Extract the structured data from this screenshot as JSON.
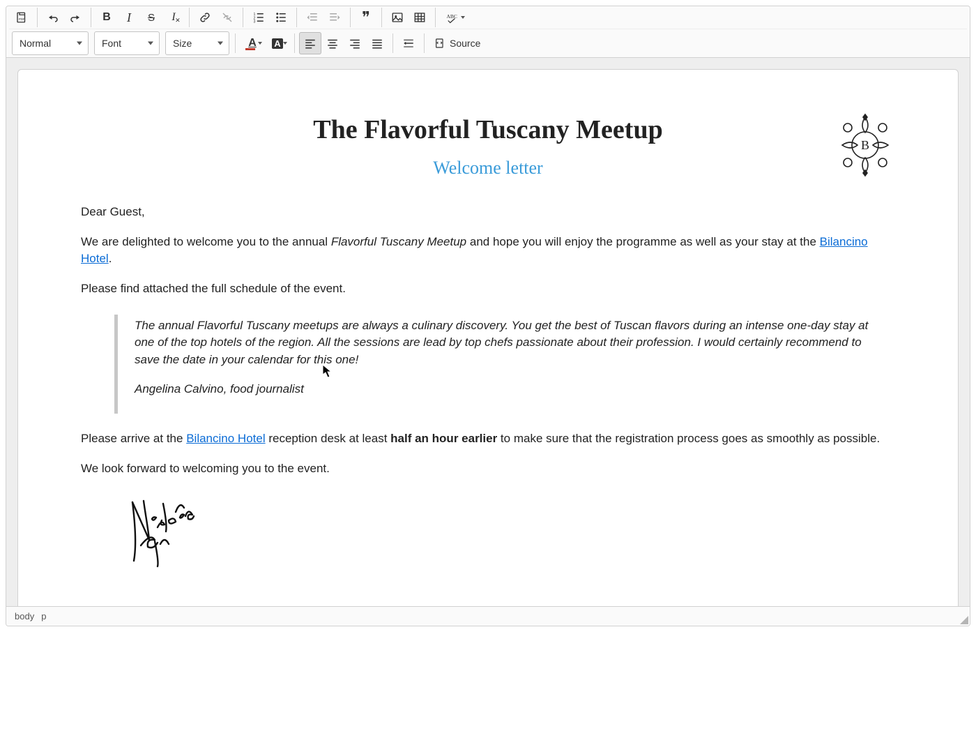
{
  "toolbar": {
    "format_heading": "Normal",
    "font_label": "Font",
    "size_label": "Size",
    "source_label": "Source"
  },
  "colors": {
    "text_color": "#c0392b",
    "accent": "#3a9bd9",
    "link": "#0b6cd6"
  },
  "document": {
    "title": "The Flavorful Tuscany Meetup",
    "subtitle": "Welcome letter",
    "greeting": "Dear Guest,",
    "intro_before_italic": "We are delighted to welcome you to the annual ",
    "intro_italic": "Flavorful Tuscany Meetup",
    "intro_after_italic": " and hope you will enjoy the programme as well as your stay at the ",
    "link_hotel": "Bilancino Hotel",
    "intro_end": ".",
    "schedule_line": "Please find attached the full schedule of the event.",
    "quote_body": "The annual Flavorful Tuscany meetups are always a culinary discovery. You get the best of Tuscan flavors during an intense one-day stay at one of the top hotels of the region. All the sessions are lead by top chefs passionate about their profession. I would certainly recommend to save the date in your calendar for this one!",
    "quote_attr": "Angelina Calvino, food journalist",
    "arrive_before_link": "Please arrive at the ",
    "arrive_after_link": " reception desk at least ",
    "arrive_bold": "half an hour earlier",
    "arrive_end": " to make sure that the registration process goes as smoothly as possible.",
    "closing": "We look forward to welcoming you to the event.",
    "signature_name": "Victoria Valc"
  },
  "status": {
    "path1": "body",
    "path2": "p"
  },
  "logo_letter": "B"
}
